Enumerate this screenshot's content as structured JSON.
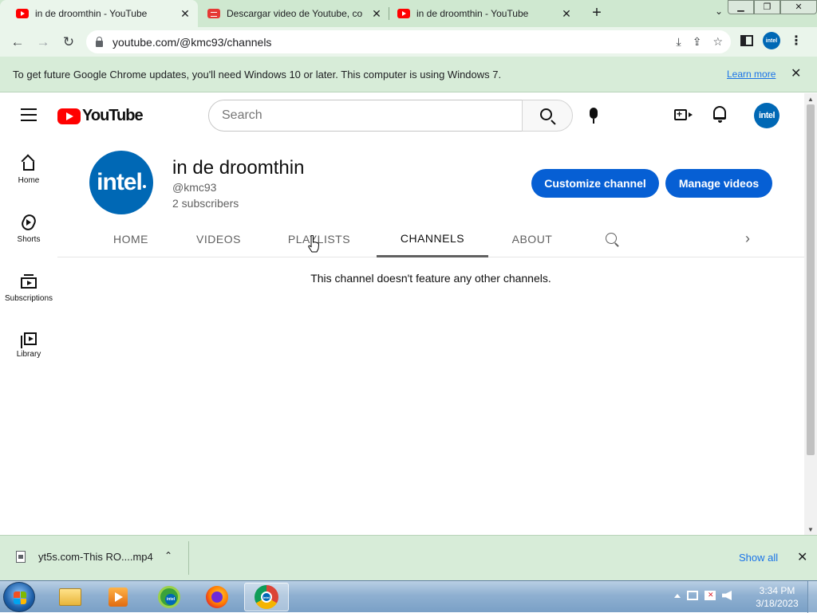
{
  "browser": {
    "tabs": [
      {
        "title": "in de droomthin - YouTube",
        "active": true
      },
      {
        "title": "Descargar video de Youtube, con",
        "active": false
      },
      {
        "title": "in de droomthin - YouTube",
        "active": false
      }
    ],
    "close_glyph": "✕",
    "newtab_glyph": "+",
    "tabsearch_glyph": "⌄",
    "window_buttons": {
      "minimize": "▁",
      "maximize": "❐",
      "close": "✕"
    },
    "nav": {
      "back": "←",
      "forward": "→",
      "reload": "↻"
    },
    "url": "youtube.com/@kmc93/channels",
    "omnibox_icons": {
      "install": "⤓",
      "share": "⇪",
      "bookmark": "☆"
    },
    "profile_label": "intel",
    "menu_glyph": "⋮",
    "infobar": {
      "message": "To get future Google Chrome updates, you'll need Windows 10 or later. This computer is using Windows 7.",
      "link": "Learn more",
      "close": "✕"
    }
  },
  "youtube": {
    "logo_text": "YouTube",
    "search_placeholder": "Search",
    "avatar_label": "intel",
    "create_plus": "+",
    "guide": [
      {
        "label": "Home",
        "icon": "home-icon"
      },
      {
        "label": "Shorts",
        "icon": "shorts-icon"
      },
      {
        "label": "Subscriptions",
        "icon": "subscriptions-icon"
      },
      {
        "label": "Library",
        "icon": "library-icon"
      }
    ],
    "channel": {
      "avatar_text": "intel",
      "name": "in de droomthin",
      "handle": "@kmc93",
      "subscribers": "2 subscribers",
      "customize_label": "Customize channel",
      "manage_label": "Manage videos"
    },
    "tabs": [
      {
        "label": "HOME",
        "active": false
      },
      {
        "label": "VIDEOS",
        "active": false
      },
      {
        "label": "PLAYLISTS",
        "active": false
      },
      {
        "label": "CHANNELS",
        "active": true
      },
      {
        "label": "ABOUT",
        "active": false
      }
    ],
    "tabs_next": "›",
    "empty_message": "This channel doesn't feature any other channels."
  },
  "scrollbar": {
    "up": "▲",
    "down": "▼"
  },
  "download_bar": {
    "filename": "yt5s.com-This RO....mp4",
    "chevron": "⌃",
    "show_all": "Show all",
    "close": "✕"
  },
  "taskbar": {
    "app_badge": "intel",
    "time": "3:34 PM",
    "date": "3/18/2023"
  },
  "colors": {
    "chrome_frame": "#cfe8d0",
    "chrome_toolbar": "#eaf5eb",
    "youtube_red": "#ff0000",
    "primary_button": "#065fd4",
    "intel_blue": "#0068b5"
  }
}
